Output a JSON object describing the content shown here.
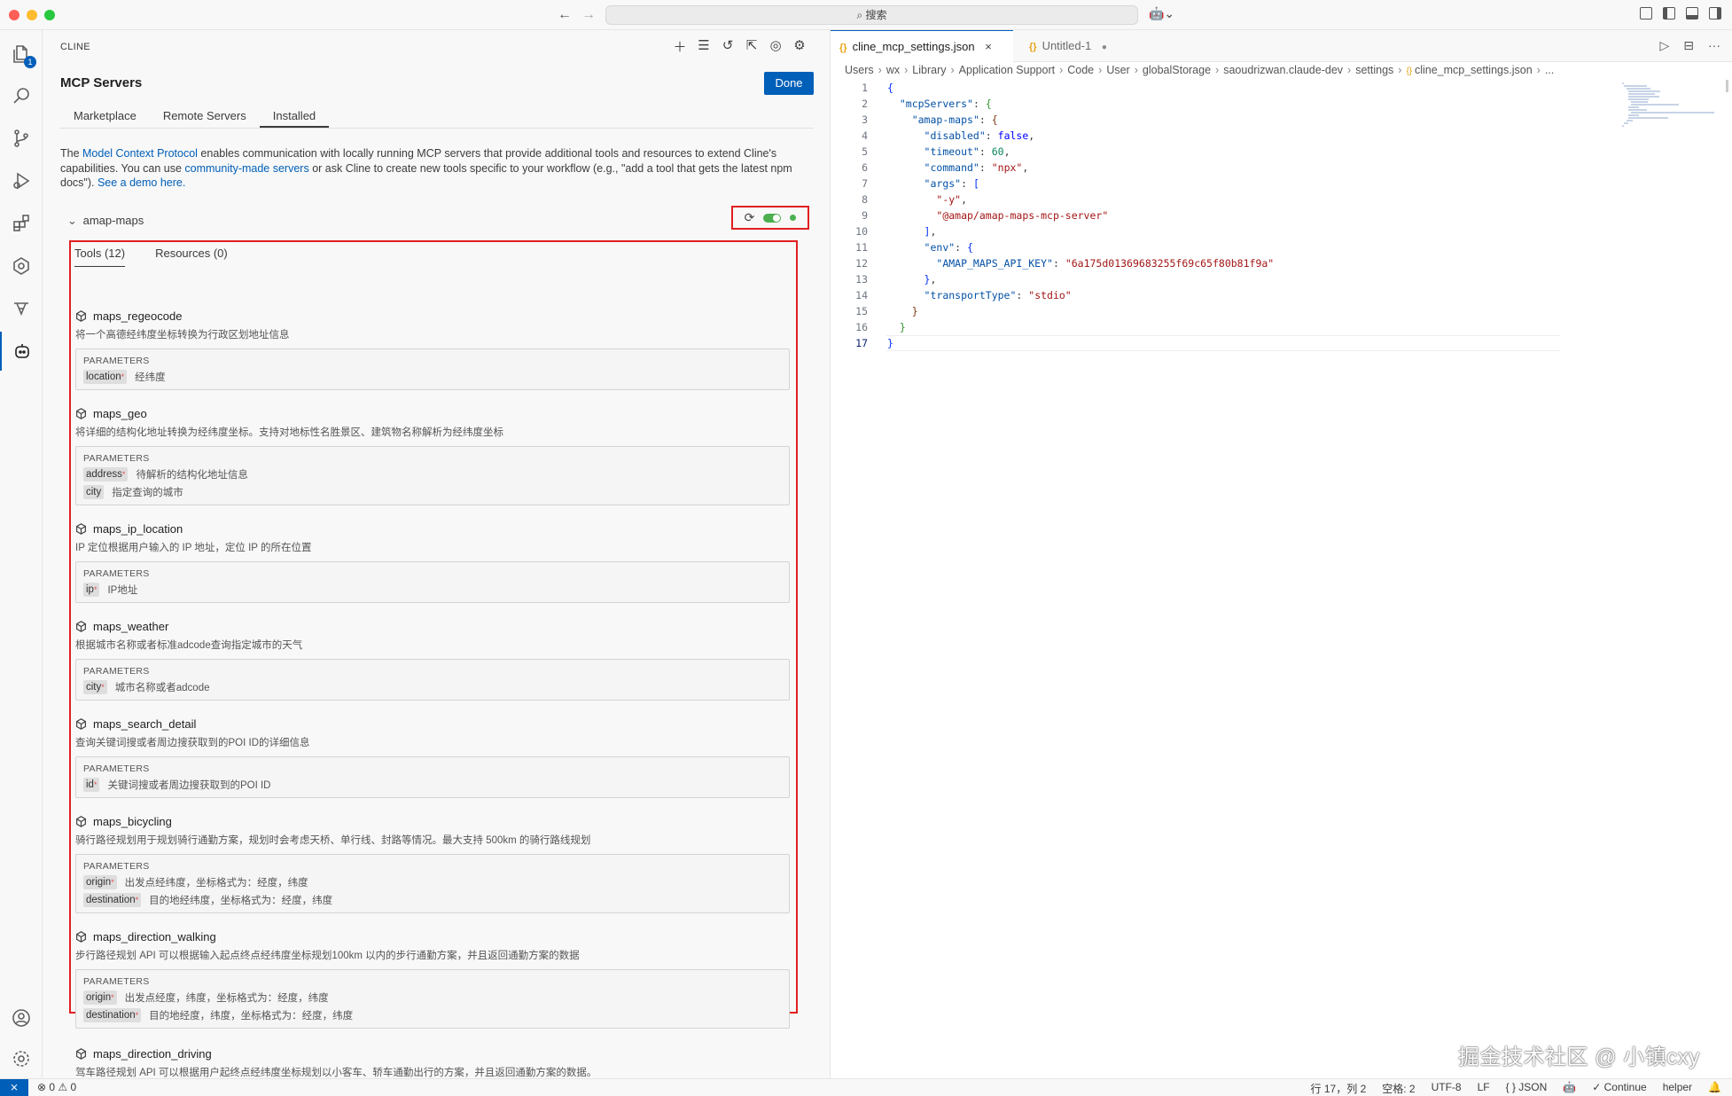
{
  "titlebar": {
    "search_label": "⌕ 搜索",
    "copilot_icon": "copilot-icon"
  },
  "activity": {
    "explorer_badge": "1"
  },
  "sidebar": {
    "panel_title": "CLINE",
    "mcp_title": "MCP Servers",
    "done_label": "Done",
    "tabs": [
      "Marketplace",
      "Remote Servers",
      "Installed"
    ],
    "intro": {
      "p1": "The ",
      "link1": "Model Context Protocol",
      "p2": " enables communication with locally running MCP servers that provide additional tools and resources to extend Cline's capabilities. You can use ",
      "link2": "community-made servers",
      "p3": " or ask Cline to create new tools specific to your workflow (e.g., \"add a tool that gets the latest npm docs\"). ",
      "link3": "See a demo here."
    },
    "server_name": "amap-maps",
    "inner_tabs": [
      "Tools (12)",
      "Resources (0)"
    ],
    "params_label": "PARAMETERS",
    "tools": [
      {
        "name": "maps_regeocode",
        "desc": "将一个高德经纬度坐标转换为行政区划地址信息",
        "params": [
          {
            "name": "location",
            "required": true,
            "desc": "经纬度"
          }
        ]
      },
      {
        "name": "maps_geo",
        "desc": "将详细的结构化地址转换为经纬度坐标。支持对地标性名胜景区、建筑物名称解析为经纬度坐标",
        "params": [
          {
            "name": "address",
            "required": true,
            "desc": "待解析的结构化地址信息"
          },
          {
            "name": "city",
            "required": false,
            "desc": "指定查询的城市"
          }
        ]
      },
      {
        "name": "maps_ip_location",
        "desc": "IP 定位根据用户输入的 IP 地址，定位 IP 的所在位置",
        "params": [
          {
            "name": "ip",
            "required": true,
            "desc": "IP地址"
          }
        ]
      },
      {
        "name": "maps_weather",
        "desc": "根据城市名称或者标准adcode查询指定城市的天气",
        "params": [
          {
            "name": "city",
            "required": true,
            "desc": "城市名称或者adcode"
          }
        ]
      },
      {
        "name": "maps_search_detail",
        "desc": "查询关键词搜或者周边搜获取到的POI ID的详细信息",
        "params": [
          {
            "name": "id",
            "required": true,
            "desc": "关键词搜或者周边搜获取到的POI ID"
          }
        ]
      },
      {
        "name": "maps_bicycling",
        "desc": "骑行路径规划用于规划骑行通勤方案，规划时会考虑天桥、单行线、封路等情况。最大支持 500km 的骑行路线规划",
        "params": [
          {
            "name": "origin",
            "required": true,
            "desc": "出发点经纬度，坐标格式为：经度，纬度"
          },
          {
            "name": "destination",
            "required": true,
            "desc": "目的地经纬度，坐标格式为：经度，纬度"
          }
        ]
      },
      {
        "name": "maps_direction_walking",
        "desc": "步行路径规划 API 可以根据输入起点终点经纬度坐标规划100km 以内的步行通勤方案，并且返回通勤方案的数据",
        "params": [
          {
            "name": "origin",
            "required": true,
            "desc": "出发点经度，纬度，坐标格式为：经度，纬度"
          },
          {
            "name": "destination",
            "required": true,
            "desc": "目的地经度，纬度，坐标格式为：经度，纬度"
          }
        ]
      },
      {
        "name": "maps_direction_driving",
        "desc": "驾车路径规划 API 可以根据用户起终点经纬度坐标规划以小客车、轿车通勤出行的方案，并且返回通勤方案的数据。",
        "params": []
      }
    ]
  },
  "editor": {
    "tabs": [
      {
        "label": "cline_mcp_settings.json",
        "close": "×"
      },
      {
        "label": "Untitled-1",
        "close": "●"
      }
    ],
    "breadcrumb": [
      "Users",
      "wx",
      "Library",
      "Application Support",
      "Code",
      "User",
      "globalStorage",
      "saoudrizwan.claude-dev",
      "settings",
      "cline_mcp_settings.json",
      "..."
    ],
    "current_line": "17",
    "code_lines": [
      "{",
      "  \"mcpServers\": {",
      "    \"amap-maps\": {",
      "      \"disabled\": false,",
      "      \"timeout\": 60,",
      "      \"command\": \"npx\",",
      "      \"args\": [",
      "        \"-y\",",
      "        \"@amap/amap-maps-mcp-server\"",
      "      ],",
      "      \"env\": {",
      "        \"AMAP_MAPS_API_KEY\": \"6a175d01369683255f69c65f80b81f9a\"",
      "      },",
      "      \"transportType\": \"stdio\"",
      "    }",
      "  }",
      "}"
    ]
  },
  "watermark": "掘金技术社区 @ 小镇cxy",
  "statusbar": {
    "remote": "⨯",
    "problems": "⊗ 0 ⚠ 0",
    "position": "行 17，列 2",
    "spaces": "空格: 2",
    "encoding": "UTF-8",
    "eol": "LF",
    "language": "{ } JSON",
    "continue": "✓ Continue",
    "helper": "helper"
  }
}
